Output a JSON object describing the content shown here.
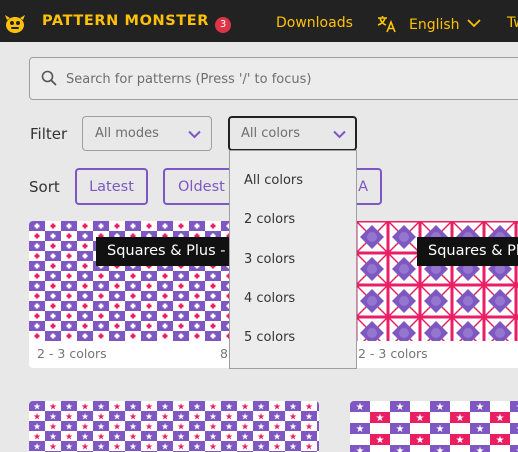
{
  "nav": {
    "brand": "PATTERN MONSTER",
    "badge_count": "3",
    "downloads_label": "Downloads",
    "language_label": "English",
    "next_link_label": "Tw"
  },
  "search": {
    "placeholder": "Search for patterns (Press '/' to focus)"
  },
  "filter": {
    "label": "Filter",
    "modes_value": "All modes",
    "colors_value": "All colors",
    "colors_options": [
      "All colors",
      "2 colors",
      "3 colors",
      "4 colors",
      "5 colors"
    ]
  },
  "sort": {
    "label": "Sort",
    "options": [
      "Latest",
      "Oldest",
      "A"
    ]
  },
  "cards": [
    {
      "title": "Squares & Plus - ",
      "meta": "2 - 3 colors",
      "meta_right": "8"
    },
    {
      "title": "Squares & Pl",
      "meta": "2 - 3 colors"
    }
  ],
  "colors": {
    "nav_bg": "#222222",
    "brand": "#ffc107",
    "accent": "#7e57c2",
    "badge": "#dc3545",
    "pattern_purple": "#7e57c2",
    "pattern_pink": "#e91e63"
  }
}
